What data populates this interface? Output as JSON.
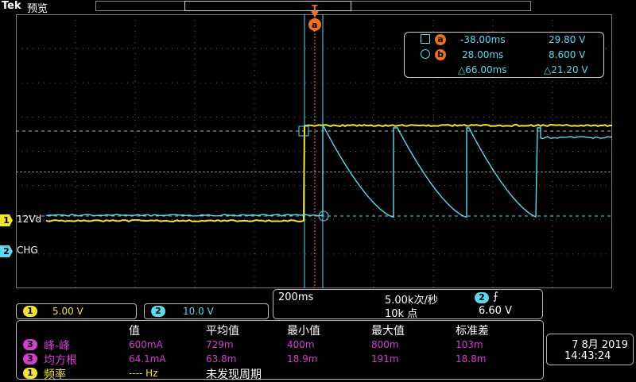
{
  "header": {
    "brand": "Tek",
    "mode": "预览"
  },
  "trigger": {
    "marker_label": "T"
  },
  "cursors": {
    "a": {
      "tag": "a",
      "time": "-38.00ms",
      "volt": "29.80 V"
    },
    "b": {
      "tag": "b",
      "time": "28.00ms",
      "volt": "8.600 V"
    },
    "delta": {
      "time": "△66.00ms",
      "volt": "△21.20 V"
    },
    "top_marker": "a"
  },
  "channels": {
    "ch1": {
      "num": "1",
      "label": "12Vd",
      "scale": "5.00 V",
      "color": "#f2e431"
    },
    "ch2": {
      "num": "2",
      "label": "CHG",
      "scale": "10.0 V",
      "color": "#5ed8ee"
    }
  },
  "horizontal": {
    "timebase": "200ms",
    "sample_rate": "5.00k次/秒",
    "record_length": "10k 点",
    "trigger_source": "2",
    "trigger_slope": "⨍",
    "trigger_level": "6.60 V"
  },
  "measurements": {
    "headers": [
      "值",
      "平均值",
      "最小值",
      "最大值",
      "标准差"
    ],
    "rows": [
      {
        "src": "3",
        "name": "峰-峰",
        "value": "600mA",
        "mean": "729m",
        "min": "400m",
        "max": "800m",
        "std": "103m",
        "color": "#d040d0"
      },
      {
        "src": "3",
        "name": "均方根",
        "value": "64.1mA",
        "mean": "63.8m",
        "min": "18.9m",
        "max": "191m",
        "std": "18.8m",
        "color": "#d040d0"
      },
      {
        "src": "1",
        "name": "频率",
        "value": "---- Hz",
        "mean": "未发现周期",
        "min": "",
        "max": "",
        "std": "",
        "color": "#f2e431"
      }
    ]
  },
  "datetime": {
    "date": "7 8月 2019",
    "time": "14:43:24"
  },
  "colors": {
    "ch1": "#f2e431",
    "ch2": "#5ed8ee",
    "math": "#d040d0",
    "trigger": "#f07020",
    "grid": "#7a7a7a"
  }
}
